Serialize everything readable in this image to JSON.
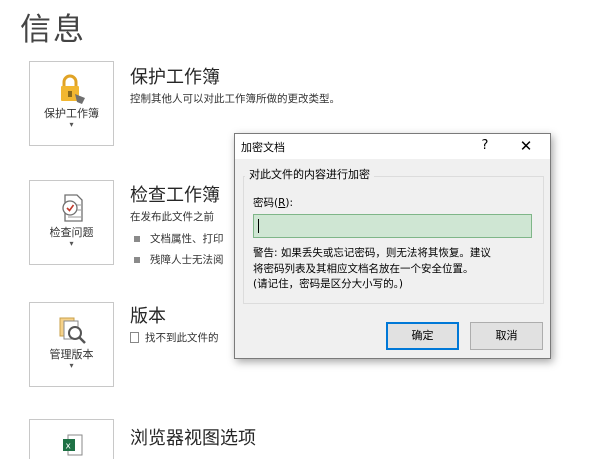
{
  "page": {
    "title": "信息"
  },
  "sections": {
    "protect": {
      "tile_label": "保护工作簿",
      "title": "保护工作簿",
      "desc": "控制其他人可以对此工作簿所做的更改类型。"
    },
    "inspect": {
      "tile_label": "检查问题",
      "title": "检查工作簿",
      "desc": "在发布此文件之前",
      "bullets": [
        "文档属性、打印",
        "残障人士无法阅"
      ]
    },
    "versions": {
      "tile_label": "管理版本",
      "title": "版本",
      "desc": "找不到此文件的"
    },
    "browser": {
      "title": "浏览器视图选项"
    },
    "caret": "▾"
  },
  "dialog": {
    "title": "加密文档",
    "help": "?",
    "close": "✕",
    "group_label": "对此文件的内容进行加密",
    "password_label_prefix": "密码(",
    "password_label_key": "R",
    "password_label_suffix": "):",
    "password_value": "",
    "warning_lines": [
      "警告: 如果丢失或忘记密码，则无法将其恢复。建议",
      "将密码列表及其相应文档名放在一个安全位置。",
      "(请记住，密码是区分大小写的。)"
    ],
    "ok": "确定",
    "cancel": "取消"
  },
  "icons": {
    "protect": "lock-icon",
    "inspect": "document-check-icon",
    "versions": "document-search-icon",
    "browser": "excel-icon"
  }
}
